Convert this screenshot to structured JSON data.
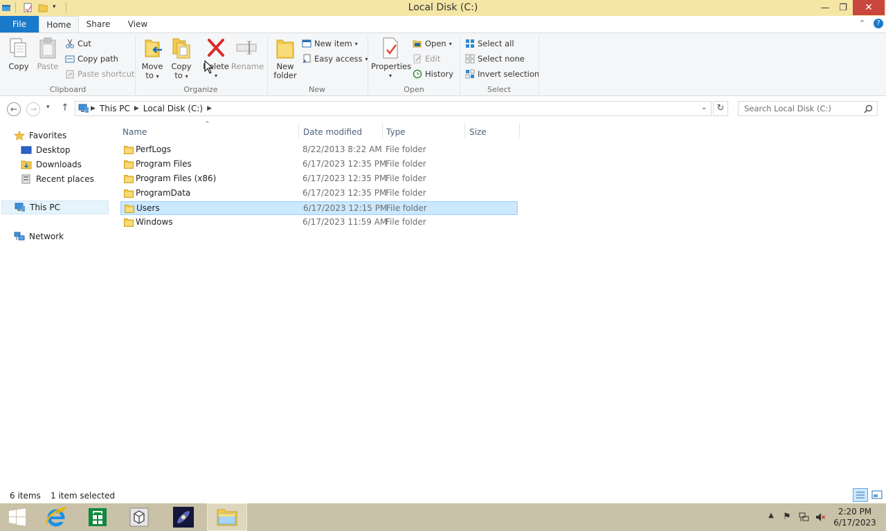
{
  "window": {
    "title": "Local Disk (C:)"
  },
  "tabs": {
    "file": "File",
    "home": "Home",
    "share": "Share",
    "view": "View"
  },
  "ribbon": {
    "clipboard": {
      "label": "Clipboard",
      "copy": "Copy",
      "paste": "Paste",
      "cut": "Cut",
      "copy_path": "Copy path",
      "paste_shortcut": "Paste shortcut"
    },
    "organize": {
      "label": "Organize",
      "move_to_1": "Move",
      "move_to_2": "to",
      "copy_to_1": "Copy",
      "copy_to_2": "to",
      "delete": "Delete",
      "rename": "Rename"
    },
    "new": {
      "label": "New",
      "new_folder_1": "New",
      "new_folder_2": "folder",
      "new_item": "New item",
      "easy_access": "Easy access"
    },
    "open": {
      "label": "Open",
      "properties": "Properties",
      "open": "Open",
      "edit": "Edit",
      "history": "History"
    },
    "select": {
      "label": "Select",
      "select_all": "Select all",
      "select_none": "Select none",
      "invert_selection": "Invert selection"
    }
  },
  "address": {
    "crumbs": [
      "This PC",
      "Local Disk (C:)"
    ],
    "search_placeholder": "Search Local Disk (C:)"
  },
  "nav": {
    "favorites": "Favorites",
    "desktop": "Desktop",
    "downloads": "Downloads",
    "recent": "Recent places",
    "this_pc": "This PC",
    "network": "Network"
  },
  "columns": {
    "name": "Name",
    "date": "Date modified",
    "type": "Type",
    "size": "Size"
  },
  "files": [
    {
      "name": "PerfLogs",
      "date": "8/22/2013 8:22 AM",
      "type": "File folder"
    },
    {
      "name": "Program Files",
      "date": "6/17/2023 12:35 PM",
      "type": "File folder"
    },
    {
      "name": "Program Files (x86)",
      "date": "6/17/2023 12:35 PM",
      "type": "File folder"
    },
    {
      "name": "ProgramData",
      "date": "6/17/2023 12:35 PM",
      "type": "File folder"
    },
    {
      "name": "Users",
      "date": "6/17/2023 12:15 PM",
      "type": "File folder",
      "selected": true
    },
    {
      "name": "Windows",
      "date": "6/17/2023 11:59 AM",
      "type": "File folder"
    }
  ],
  "status": {
    "count": "6 items",
    "selection": "1 item selected"
  },
  "clock": {
    "time": "2:20 PM",
    "date": "6/17/2023"
  },
  "colors": {
    "accent": "#1979ca",
    "titlebar": "#f5e6a6",
    "selection": "#cce8ff",
    "taskbar": "#c9c2a8",
    "close": "#c9463d"
  }
}
